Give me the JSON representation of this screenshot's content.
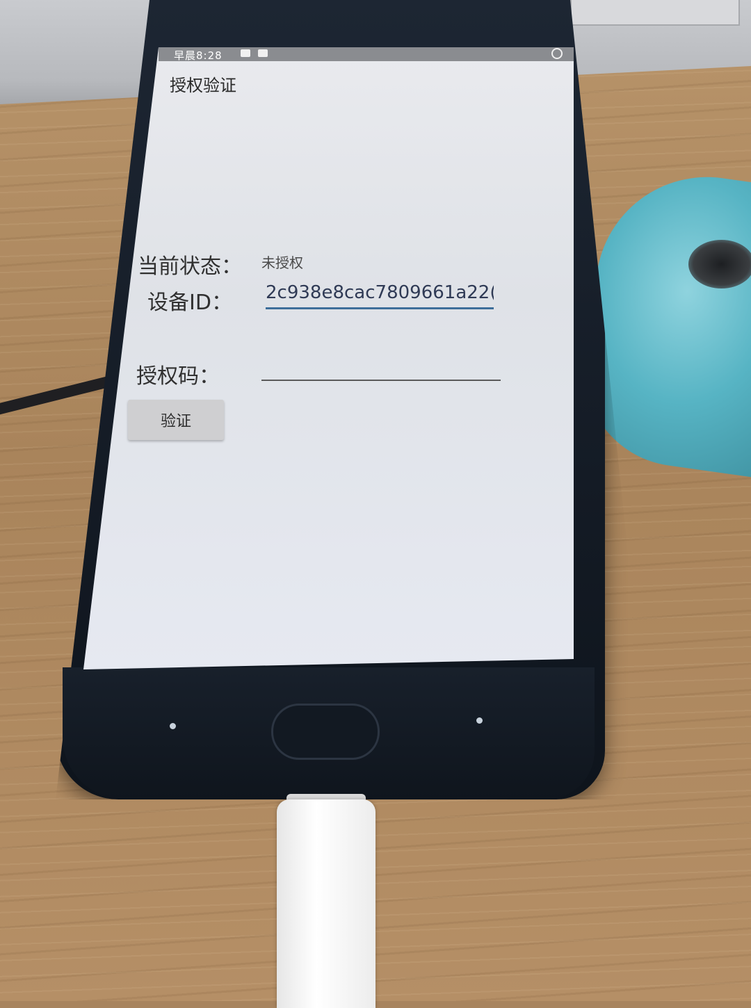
{
  "status_bar": {
    "time": "早晨8:28"
  },
  "app": {
    "title": "授权验证",
    "status_label": "当前状态：",
    "status_value": "未授权",
    "device_id_label": "设备ID：",
    "device_id_value": "2c938e8cac7809661a22(",
    "auth_code_label": "授权码：",
    "auth_code_value": "",
    "verify_button": "验证"
  },
  "colors": {
    "input_underline": "#3d6e9a",
    "button_bg": "#cfcfd1",
    "screen_bg": "#e6e9ee"
  }
}
